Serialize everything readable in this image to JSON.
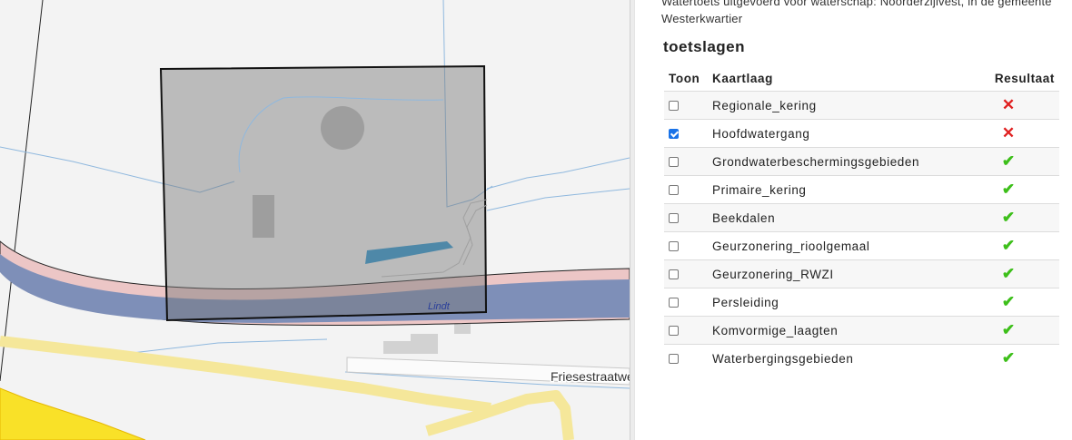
{
  "map": {
    "street_label": "Friesestraatwe",
    "water_label": "Lindt"
  },
  "panel": {
    "intro_text": "Watertoets uitgevoerd voor waterschap: Noorderzijlvest, in de gemeente Westerkwartier",
    "section_title": "toetslagen",
    "columns": {
      "toon": "Toon",
      "kaartlaag": "Kaartlaag",
      "resultaat": "Resultaat"
    },
    "rows": [
      {
        "layer": "Regionale_kering",
        "checked": false,
        "result": "fail",
        "result_icon": "cross-icon"
      },
      {
        "layer": "Hoofdwatergang",
        "checked": true,
        "result": "fail",
        "result_icon": "cross-icon"
      },
      {
        "layer": "Grondwaterbeschermingsgebieden",
        "checked": false,
        "result": "pass",
        "result_icon": "check-icon"
      },
      {
        "layer": "Primaire_kering",
        "checked": false,
        "result": "pass",
        "result_icon": "check-icon"
      },
      {
        "layer": "Beekdalen",
        "checked": false,
        "result": "pass",
        "result_icon": "check-icon"
      },
      {
        "layer": "Geurzonering_rioolgemaal",
        "checked": false,
        "result": "pass",
        "result_icon": "check-icon"
      },
      {
        "layer": "Geurzonering_RWZI",
        "checked": false,
        "result": "pass",
        "result_icon": "check-icon"
      },
      {
        "layer": "Persleiding",
        "checked": false,
        "result": "pass",
        "result_icon": "check-icon"
      },
      {
        "layer": "Komvormige_laagten",
        "checked": false,
        "result": "pass",
        "result_icon": "check-icon"
      },
      {
        "layer": "Waterbergingsgebieden",
        "checked": false,
        "result": "pass",
        "result_icon": "check-icon"
      }
    ],
    "colors": {
      "fail": "#e02020",
      "pass": "#3dbf1a",
      "checkbox_on": "#1a73e8"
    }
  }
}
